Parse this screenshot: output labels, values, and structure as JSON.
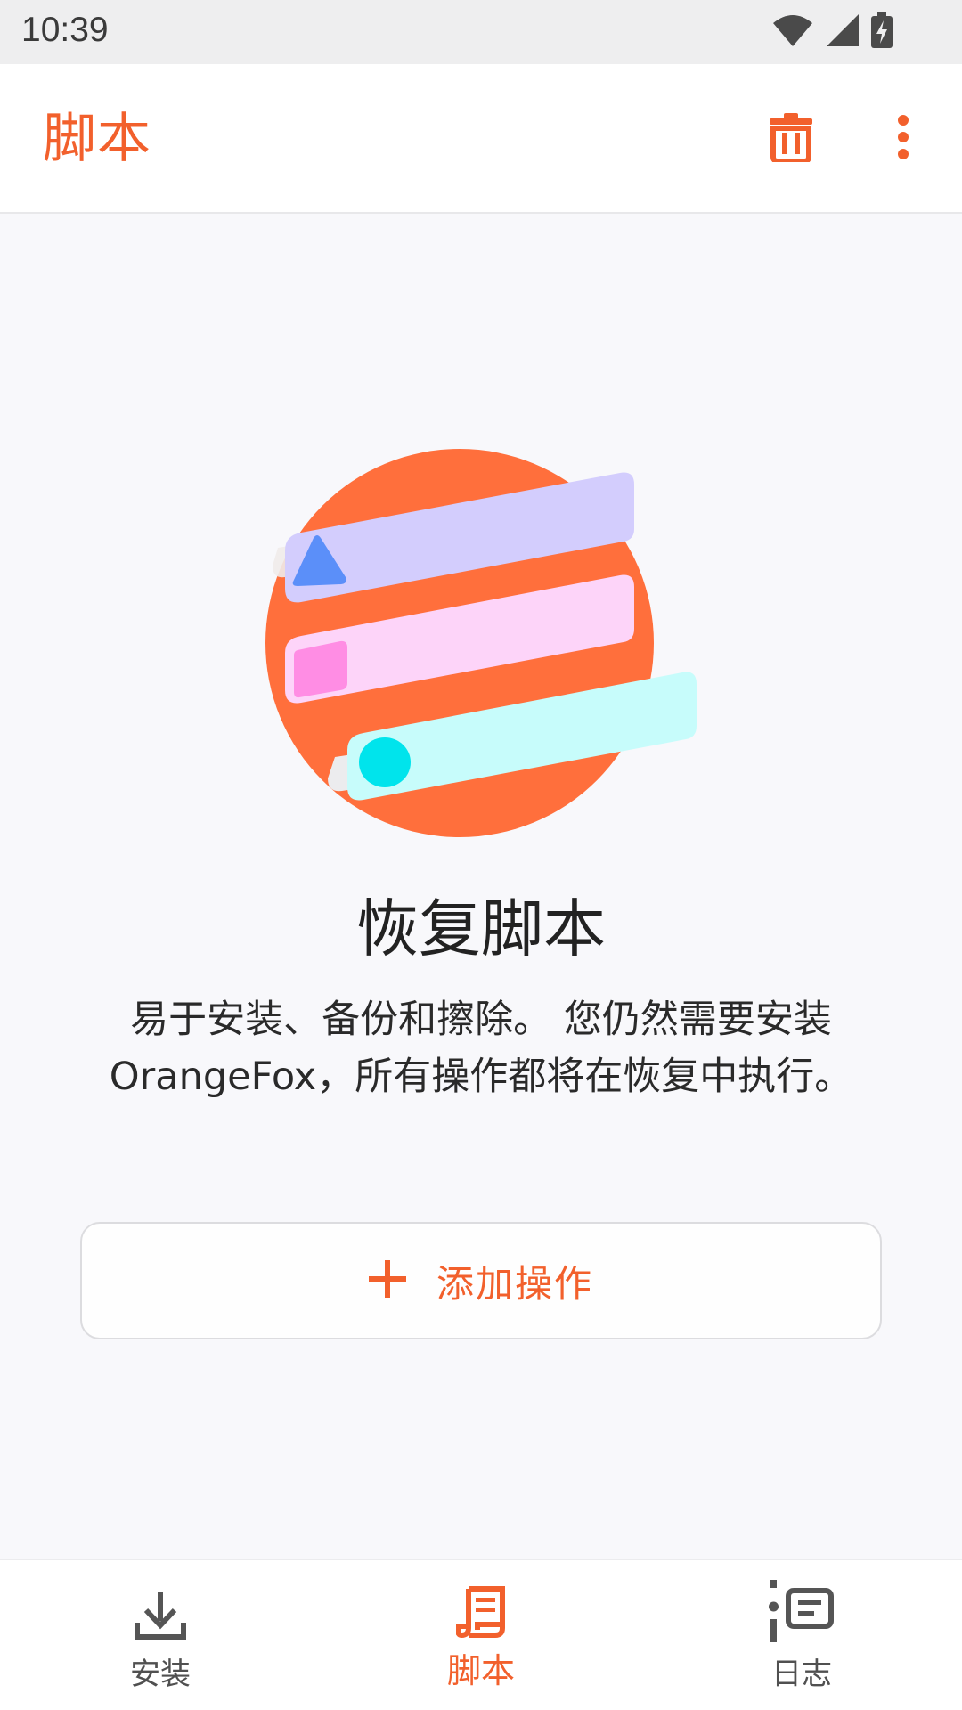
{
  "status_bar": {
    "time": "10:39",
    "icons": [
      "wifi-icon",
      "cell-signal-icon",
      "battery-charging-icon"
    ]
  },
  "app_bar": {
    "title": "脚本",
    "actions": [
      "trash-icon",
      "more-vert-icon"
    ]
  },
  "empty_state": {
    "illustration": "script-list-illustration",
    "headline": "恢复脚本",
    "description": "易于安装、备份和擦除。 您仍然需要安装OrangeFox，所有操作都将在恢复中执行。",
    "add_button": {
      "icon": "plus-icon",
      "label": "添加操作"
    }
  },
  "bottom_nav": {
    "items": [
      {
        "label": "安装",
        "icon": "download-icon",
        "active": false
      },
      {
        "label": "脚本",
        "icon": "script-icon",
        "active": true
      },
      {
        "label": "日志",
        "icon": "log-icon",
        "active": false
      }
    ]
  },
  "colors": {
    "accent": "#f2602c",
    "circle": "#ff6f3c",
    "bar_purple": "#d3cdfd",
    "bar_pink": "#fdd4f9",
    "bar_cyan": "#c7fcfb",
    "triangle": "#5b8ff9",
    "square": "#ff8de4",
    "dot": "#00e4ec"
  }
}
